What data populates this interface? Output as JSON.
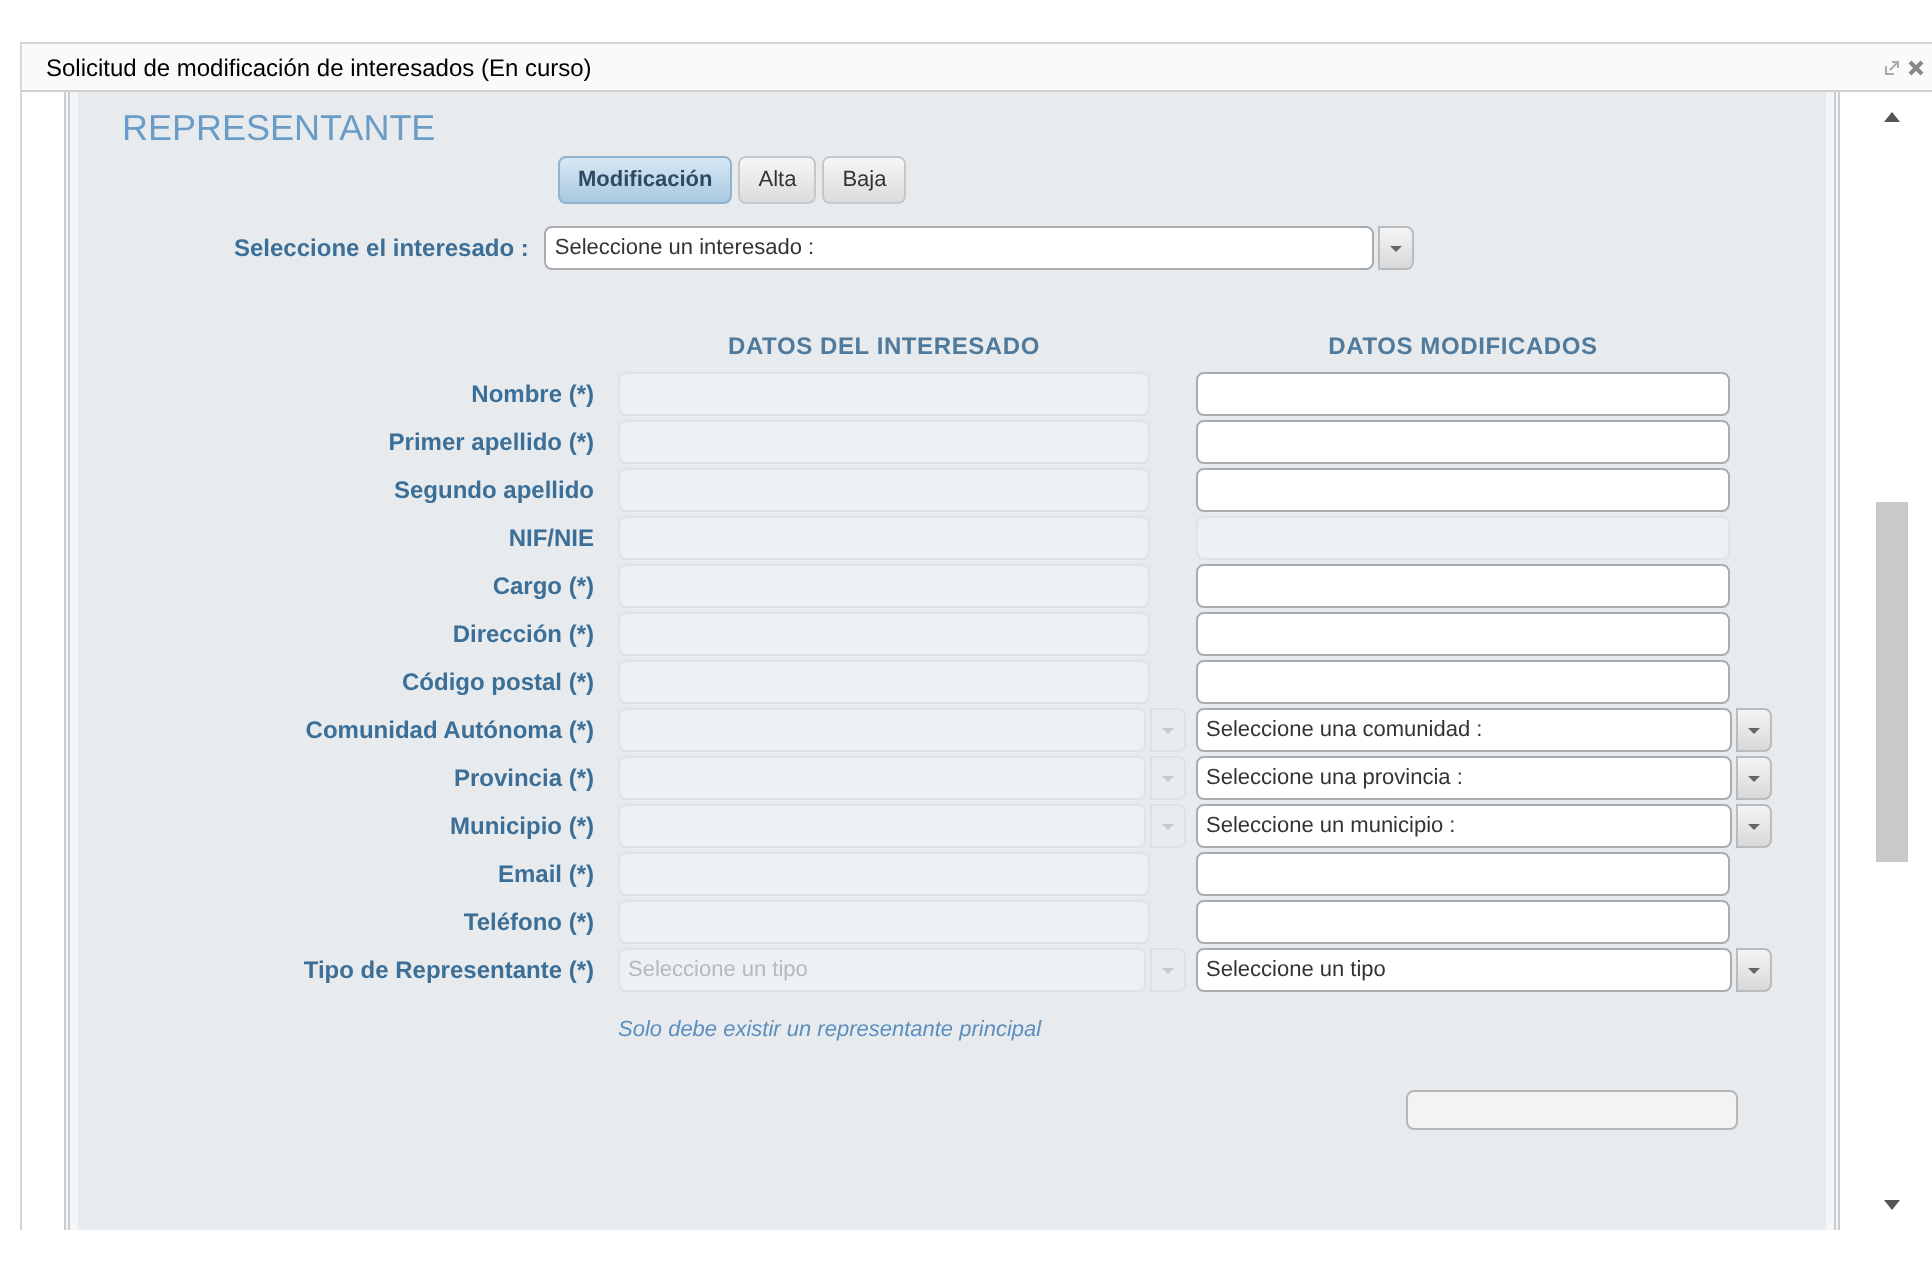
{
  "window": {
    "title": "Solicitud de modificación de interesados (En curso)"
  },
  "section_title": "REPRESENTANTE",
  "tabs": [
    {
      "label": "Modificación",
      "selected": true
    },
    {
      "label": "Alta",
      "selected": false
    },
    {
      "label": "Baja",
      "selected": false
    }
  ],
  "interesado": {
    "label": "Seleccione el interesado :",
    "placeholder": "Seleccione un interesado :"
  },
  "columns": [
    "DATOS DEL INTERESADO",
    "DATOS MODIFICADOS"
  ],
  "rows": [
    {
      "label": "Nombre (*)",
      "left": {
        "kind": "text",
        "disabled": true
      },
      "right": {
        "kind": "text",
        "disabled": false
      }
    },
    {
      "label": "Primer apellido (*)",
      "left": {
        "kind": "text",
        "disabled": true
      },
      "right": {
        "kind": "text",
        "disabled": false
      }
    },
    {
      "label": "Segundo apellido",
      "left": {
        "kind": "text",
        "disabled": true
      },
      "right": {
        "kind": "text",
        "disabled": false
      }
    },
    {
      "label": "NIF/NIE",
      "left": {
        "kind": "text",
        "disabled": true
      },
      "right": {
        "kind": "text",
        "disabled": true
      }
    },
    {
      "label": "Cargo (*)",
      "left": {
        "kind": "text",
        "disabled": true
      },
      "right": {
        "kind": "text",
        "disabled": false
      }
    },
    {
      "label": "Dirección (*)",
      "left": {
        "kind": "text",
        "disabled": true
      },
      "right": {
        "kind": "text",
        "disabled": false
      }
    },
    {
      "label": "Código postal (*)",
      "left": {
        "kind": "text",
        "disabled": true
      },
      "right": {
        "kind": "text",
        "disabled": false
      }
    },
    {
      "label": "Comunidad Autónoma (*)",
      "left": {
        "kind": "select",
        "disabled": true
      },
      "right": {
        "kind": "select",
        "disabled": false,
        "placeholder": "Seleccione una comunidad :"
      }
    },
    {
      "label": "Provincia (*)",
      "left": {
        "kind": "select",
        "disabled": true
      },
      "right": {
        "kind": "select",
        "disabled": false,
        "placeholder": "Seleccione una provincia :"
      }
    },
    {
      "label": "Municipio (*)",
      "left": {
        "kind": "select",
        "disabled": true
      },
      "right": {
        "kind": "select",
        "disabled": false,
        "placeholder": "Seleccione un municipio :"
      }
    },
    {
      "label": "Email (*)",
      "left": {
        "kind": "text",
        "disabled": true
      },
      "right": {
        "kind": "text",
        "disabled": false
      }
    },
    {
      "label": "Teléfono (*)",
      "left": {
        "kind": "text",
        "disabled": true
      },
      "right": {
        "kind": "text",
        "disabled": false
      }
    },
    {
      "label": "Tipo de Representante (*)",
      "left": {
        "kind": "select",
        "disabled": true,
        "placeholder": "Seleccione un tipo"
      },
      "right": {
        "kind": "select",
        "disabled": false,
        "placeholder": "Seleccione un tipo"
      }
    }
  ],
  "note": "Solo debe existir un representante principal"
}
